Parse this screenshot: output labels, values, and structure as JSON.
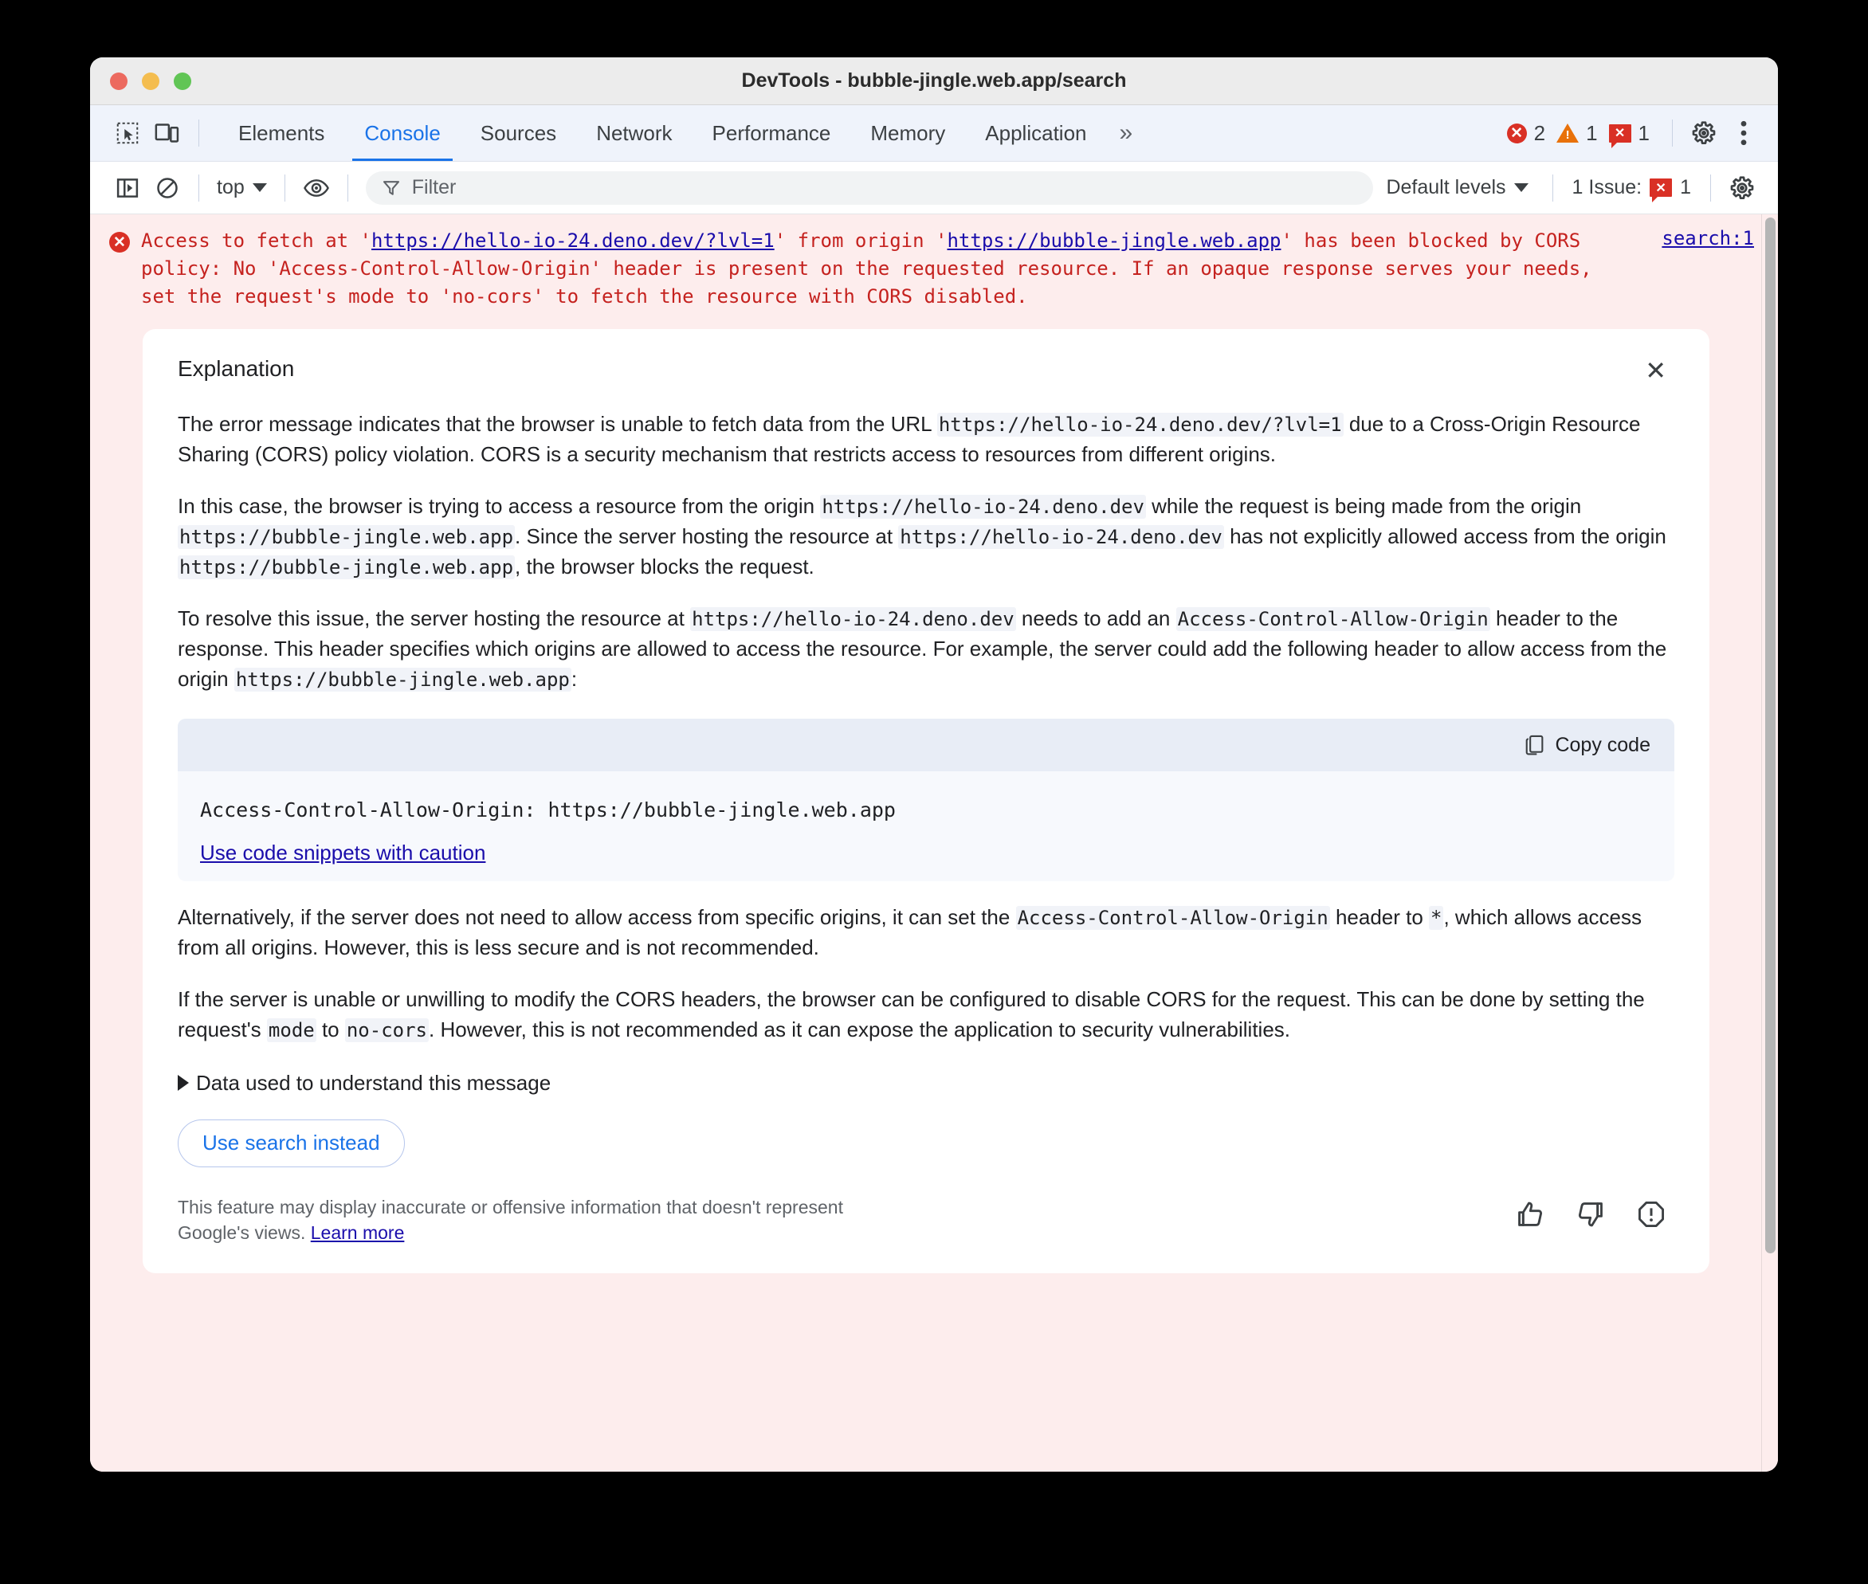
{
  "window": {
    "title": "DevTools - bubble-jingle.web.app/search",
    "traffic_lights": [
      "close-red",
      "minimize-yellow",
      "maximize-green"
    ]
  },
  "tabbar": {
    "inspect_icon": "inspect-element-icon",
    "device_icon": "device-toolbar-icon",
    "tabs": [
      {
        "label": "Elements",
        "active": false
      },
      {
        "label": "Console",
        "active": true
      },
      {
        "label": "Sources",
        "active": false
      },
      {
        "label": "Network",
        "active": false
      },
      {
        "label": "Performance",
        "active": false
      },
      {
        "label": "Memory",
        "active": false
      },
      {
        "label": "Application",
        "active": false
      }
    ],
    "more_tabs": "»",
    "error_count": "2",
    "warning_count": "1",
    "issue_count": "1",
    "error_glyph": "✕",
    "warning_glyph": "!",
    "issue_glyph": "✕",
    "settings_icon": "gear-icon",
    "more_icon": "kebab-menu-icon"
  },
  "toolbar": {
    "sidebar_icon": "console-sidebar-icon",
    "clear_icon": "clear-console-icon",
    "context": "top",
    "eye_icon": "live-expression-icon",
    "filter_icon": "filter-funnel-icon",
    "filter_placeholder": "Filter",
    "filter_value": "",
    "levels": "Default levels",
    "issues_label": "1 Issue:",
    "issues_count": "1",
    "issues_glyph": "✕",
    "settings_icon": "gear-icon"
  },
  "console": {
    "error_glyph": "✕",
    "message_parts": [
      {
        "type": "text",
        "value": "Access to fetch at '"
      },
      {
        "type": "link",
        "value": "https://hello-io-24.deno.dev/?lvl=1"
      },
      {
        "type": "text",
        "value": "' from origin '"
      },
      {
        "type": "link",
        "value": "https://bubble-jingle.web.app"
      },
      {
        "type": "text",
        "value": "' has been blocked by CORS policy: No 'Access-Control-Allow-Origin' header is present on the requested resource. If an opaque response serves your needs, set the request's mode to 'no-cors' to fetch the resource with CORS disabled."
      }
    ],
    "source_link": "search:1"
  },
  "explanation": {
    "title": "Explanation",
    "close_glyph": "✕",
    "paragraphs": [
      {
        "id": "p1",
        "parts": [
          {
            "type": "text",
            "value": "The error message indicates that the browser is unable to fetch data from the URL "
          },
          {
            "type": "code",
            "value": "https://hello-io-24.deno.dev/?lvl=1"
          },
          {
            "type": "text",
            "value": " due to a Cross-Origin Resource Sharing (CORS) policy violation. CORS is a security mechanism that restricts access to resources from different origins."
          }
        ]
      },
      {
        "id": "p2",
        "parts": [
          {
            "type": "text",
            "value": "In this case, the browser is trying to access a resource from the origin "
          },
          {
            "type": "code",
            "value": "https://hello-io-24.deno.dev"
          },
          {
            "type": "text",
            "value": " while the request is being made from the origin "
          },
          {
            "type": "code",
            "value": "https://bubble-jingle.web.app"
          },
          {
            "type": "text",
            "value": ". Since the server hosting the resource at "
          },
          {
            "type": "code",
            "value": "https://hello-io-24.deno.dev"
          },
          {
            "type": "text",
            "value": " has not explicitly allowed access from the origin "
          },
          {
            "type": "code",
            "value": "https://bubble-jingle.web.app"
          },
          {
            "type": "text",
            "value": ", the browser blocks the request."
          }
        ]
      },
      {
        "id": "p3",
        "parts": [
          {
            "type": "text",
            "value": "To resolve this issue, the server hosting the resource at "
          },
          {
            "type": "code",
            "value": "https://hello-io-24.deno.dev"
          },
          {
            "type": "text",
            "value": " needs to add an "
          },
          {
            "type": "code",
            "value": "Access-Control-Allow-Origin"
          },
          {
            "type": "text",
            "value": " header to the response. This header specifies which origins are allowed to access the resource. For example, the server could add the following header to allow access from the origin "
          },
          {
            "type": "code",
            "value": "https://bubble-jingle.web.app"
          },
          {
            "type": "text",
            "value": ":"
          }
        ]
      }
    ],
    "code_block": {
      "copy_label": "Copy code",
      "copy_icon": "copy-icon",
      "code": "Access-Control-Allow-Origin: https://bubble-jingle.web.app",
      "caution_link": "Use code snippets with caution"
    },
    "paragraphs_after": [
      {
        "id": "p4",
        "parts": [
          {
            "type": "text",
            "value": "Alternatively, if the server does not need to allow access from specific origins, it can set the "
          },
          {
            "type": "code",
            "value": "Access-Control-Allow-Origin"
          },
          {
            "type": "text",
            "value": " header to "
          },
          {
            "type": "code",
            "value": "*"
          },
          {
            "type": "text",
            "value": ", which allows access from all origins. However, this is less secure and is not recommended."
          }
        ]
      },
      {
        "id": "p5",
        "parts": [
          {
            "type": "text",
            "value": "If the server is unable or unwilling to modify the CORS headers, the browser can be configured to disable CORS for the request. This can be done by setting the request's "
          },
          {
            "type": "code",
            "value": "mode"
          },
          {
            "type": "text",
            "value": " to "
          },
          {
            "type": "code",
            "value": "no-cors"
          },
          {
            "type": "text",
            "value": ". However, this is not recommended as it can expose the application to security vulnerabilities."
          }
        ]
      }
    ],
    "disclosure_label": "Data used to understand this message",
    "search_button": "Use search instead",
    "disclaimer_text": "This feature may display inaccurate or offensive information that doesn't represent Google's views. ",
    "disclaimer_link": "Learn more",
    "thumb_up_icon": "thumb-up-icon",
    "thumb_down_icon": "thumb-down-icon",
    "report_icon": "report-icon"
  },
  "colors": {
    "accent_blue": "#1a73e8",
    "link_blue": "#1a0dab",
    "error_red": "#d93025",
    "error_text": "#c5221f",
    "warning_orange": "#e8710a",
    "console_error_bg": "#fdeded",
    "code_bg": "#f1f3f8"
  }
}
